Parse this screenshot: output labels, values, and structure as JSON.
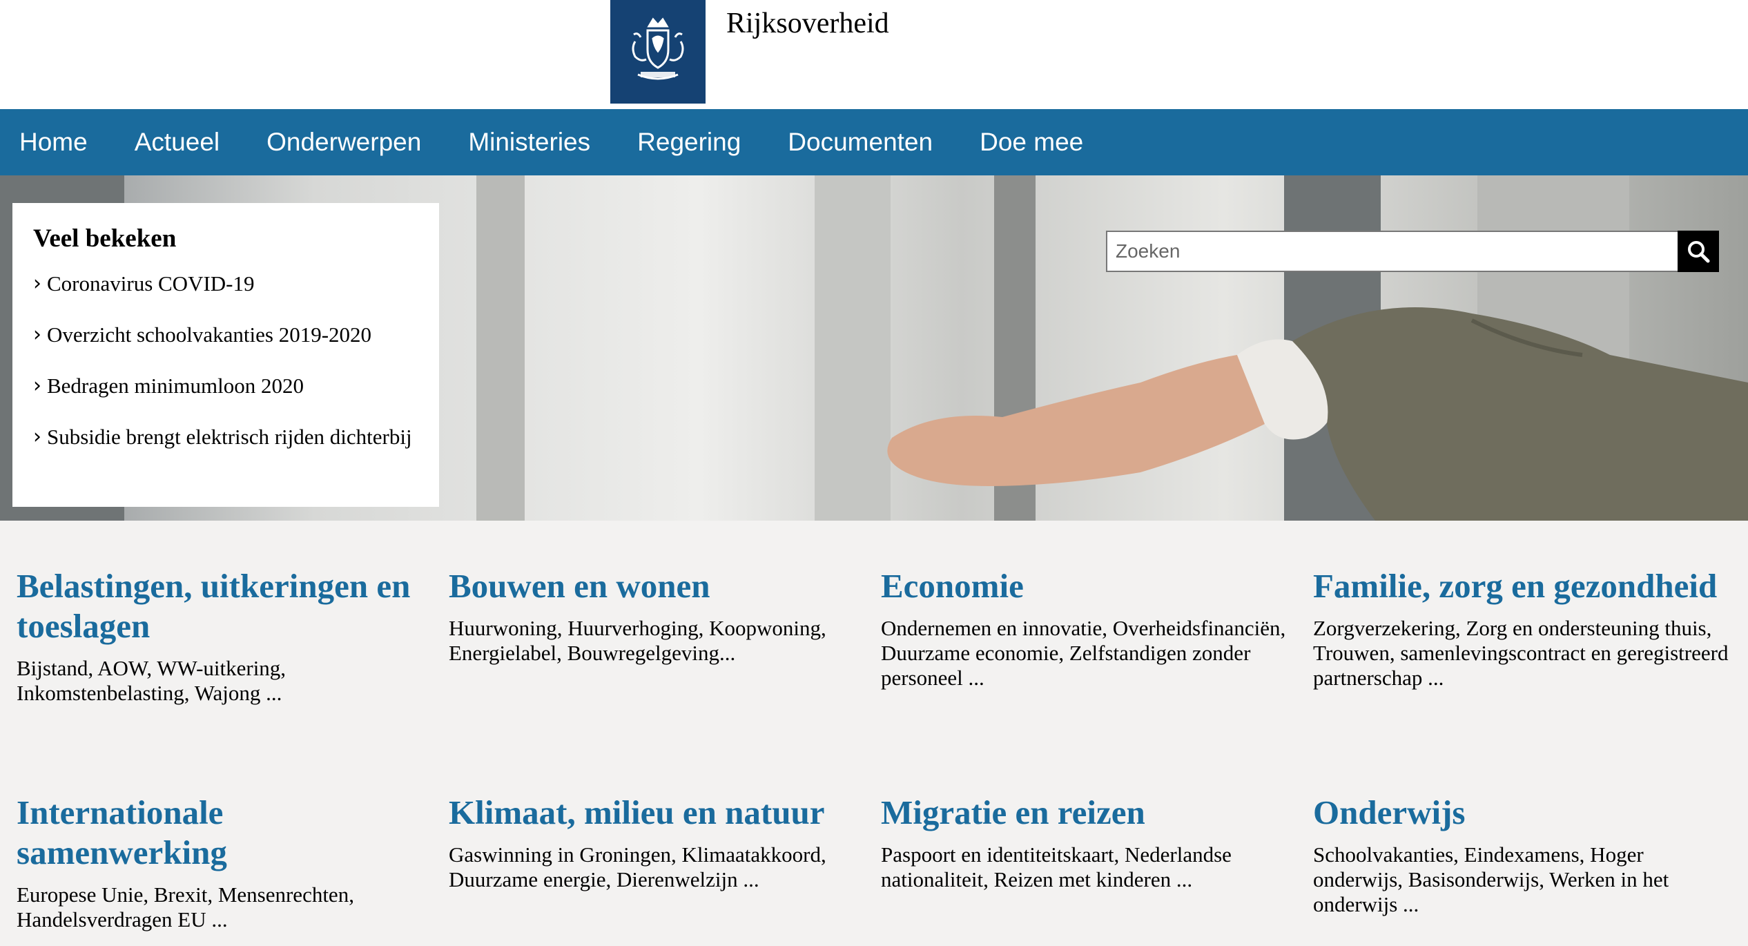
{
  "header": {
    "brand": "Rijksoverheid",
    "logo_icon": "coat-of-arms-icon",
    "logo_color": "#154273"
  },
  "nav": {
    "color": "#1a6b9d",
    "items": [
      {
        "label": "Home"
      },
      {
        "label": "Actueel"
      },
      {
        "label": "Onderwerpen"
      },
      {
        "label": "Ministeries"
      },
      {
        "label": "Regering"
      },
      {
        "label": "Documenten"
      },
      {
        "label": "Doe mee"
      }
    ]
  },
  "popular": {
    "title": "Veel bekeken",
    "links": [
      {
        "label": "Coronavirus COVID-19"
      },
      {
        "label": "Overzicht schoolvakanties 2019-2020"
      },
      {
        "label": "Bedragen minimumloon 2020"
      },
      {
        "label": "Subsidie brengt elektrisch rijden dichterbij"
      }
    ]
  },
  "search": {
    "placeholder": "Zoeken",
    "icon": "search-icon"
  },
  "topics": [
    {
      "title": "Belastingen, uitkeringen en toeslagen",
      "desc": "Bijstand, AOW, WW-uitkering, Inkomstenbelasting, Wajong ..."
    },
    {
      "title": "Bouwen en wonen",
      "desc": "Huurwoning, Huurverhoging, Koopwoning, Energielabel, Bouwregelgeving..."
    },
    {
      "title": "Economie",
      "desc": "Ondernemen en innovatie, Overheidsfinanciën, Duurzame economie, Zelfstandigen zonder personeel ..."
    },
    {
      "title": "Familie, zorg en gezondheid",
      "desc": "Zorgverzekering, Zorg en ondersteuning thuis, Trouwen, samenlevingscontract en geregistreerd partnerschap ..."
    },
    {
      "title": "Internationale samenwerking",
      "desc": "Europese Unie, Brexit, Mensenrechten, Handelsverdragen EU ..."
    },
    {
      "title": "Klimaat, milieu en natuur",
      "desc": "Gaswinning in Groningen, Klimaatakkoord, Duurzame energie, Dierenwelzijn ..."
    },
    {
      "title": "Migratie en reizen",
      "desc": "Paspoort en identiteitskaart, Nederlandse nationaliteit, Reizen met kinderen ..."
    },
    {
      "title": "Onderwijs",
      "desc": "Schoolvakanties, Eindexamens, Hoger onderwijs, Basisonderwijs, Werken in het onderwijs ..."
    }
  ]
}
